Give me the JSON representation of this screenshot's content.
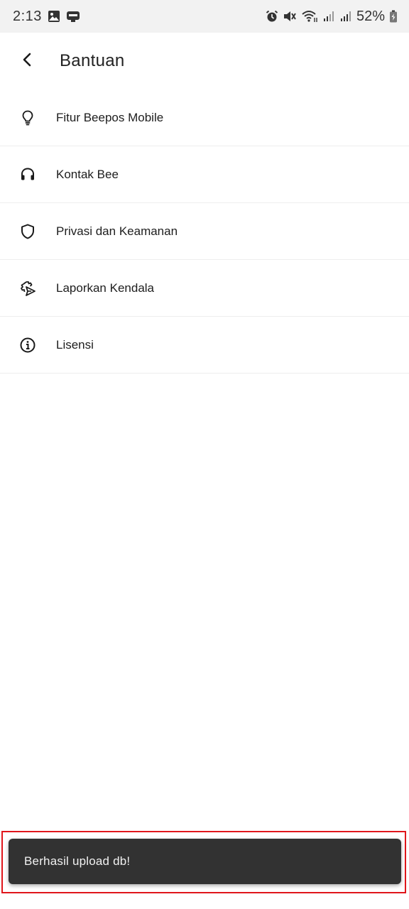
{
  "status_bar": {
    "time": "2:13",
    "battery": "52%",
    "icons": [
      "gallery-icon",
      "dept-app-icon",
      "alarm-icon",
      "mute-icon",
      "wifi-icon",
      "signal-icon",
      "signal-icon",
      "battery-icon"
    ]
  },
  "app_bar": {
    "title": "Bantuan",
    "back_icon": "chevron-left-icon"
  },
  "menu": {
    "items": [
      {
        "label": "Fitur Beepos Mobile",
        "icon": "lightbulb-icon"
      },
      {
        "label": "Kontak Bee",
        "icon": "headset-icon"
      },
      {
        "label": "Privasi dan Keamanan",
        "icon": "shield-icon"
      },
      {
        "label": "Laporkan Kendala",
        "icon": "report-send-icon"
      },
      {
        "label": "Lisensi",
        "icon": "info-icon"
      }
    ]
  },
  "snackbar": {
    "message": "Berhasil upload db!"
  },
  "colors": {
    "status_bar_bg": "#f2f2f2",
    "snackbar_bg": "#323232",
    "highlight_border": "#e0161b"
  }
}
